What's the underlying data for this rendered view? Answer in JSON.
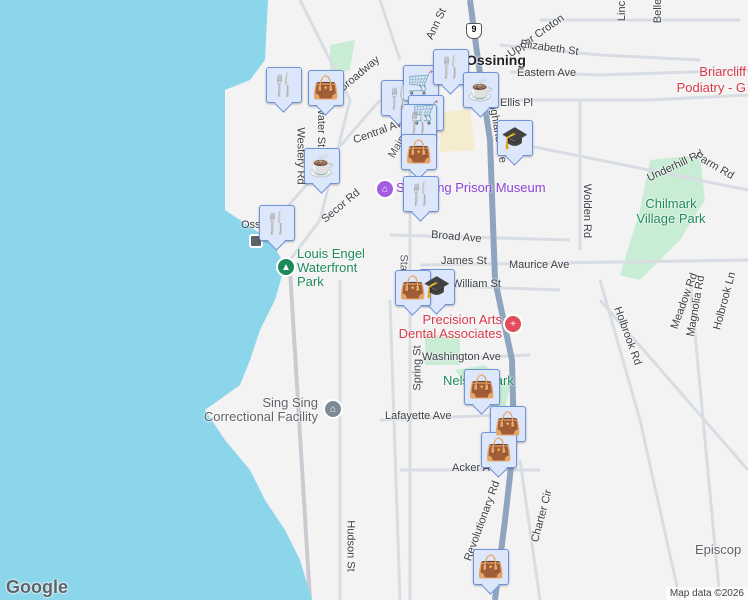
{
  "map": {
    "colors": {
      "water": "#8cd6ec",
      "land": "#f4f3f3",
      "park": "#c9ecd4",
      "highway": "#8fa4bf",
      "road": "#d8dde4",
      "marker_bg": "#dde7fb",
      "marker_icon": "#0b3f5c"
    },
    "route_shield": "9",
    "town": "Ossining",
    "streets": [
      "Upper Croton",
      "Elizabeth St",
      "Eastern Ave",
      "Ann St",
      "Broadway",
      "Water St",
      "Westery Rd",
      "Central Ave",
      "Ellis Pl",
      "Highland Ave",
      "Underhill Rd",
      "Farm Rd",
      "Wolden Rd",
      "Secor Rd",
      "Broad Ave",
      "James St",
      "Maurice Ave",
      "William St",
      "Washington Ave",
      "Spring St",
      "Lafayette Ave",
      "Acker Ave",
      "Meadow Rd",
      "Magnolia Rd",
      "Holbrook Ln",
      "Holbrook Rd",
      "Hudson St",
      "Revolutionary Rd",
      "Charter Cir",
      "Linc",
      "Belle",
      "State St",
      "Main St"
    ],
    "pois": {
      "podiatry": "Briarcliff Podiatry - G",
      "museum": "Sing Sing Prison Museum",
      "chilmark": "Chilmark Village Park",
      "waterfront": "Louis Engel Waterfront Park",
      "dental": "Precision Arts Dental Associates",
      "nelson": "Nelson Park",
      "singsing": "Sing Sing Correctional Facility",
      "episcopal": "Episcop",
      "station": "Ossining"
    },
    "markers": [
      {
        "type": "restaurant",
        "icon": "fork-knife"
      },
      {
        "type": "shopping",
        "icon": "shopping-bag"
      },
      {
        "type": "restaurant",
        "icon": "fork-knife"
      },
      {
        "type": "grocery",
        "icon": "shopping-cart"
      },
      {
        "type": "restaurant",
        "icon": "fork-knife"
      },
      {
        "type": "cafe",
        "icon": "coffee-cup"
      },
      {
        "type": "grocery",
        "icon": "shopping-cart"
      },
      {
        "type": "restaurant",
        "icon": "fork-knife"
      },
      {
        "type": "school",
        "icon": "graduation-cap"
      },
      {
        "type": "shopping",
        "icon": "shopping-bag"
      },
      {
        "type": "cafe",
        "icon": "coffee-cup"
      },
      {
        "type": "restaurant",
        "icon": "fork-knife"
      },
      {
        "type": "restaurant",
        "icon": "fork-knife"
      },
      {
        "type": "school",
        "icon": "graduation-cap"
      },
      {
        "type": "shopping",
        "icon": "shopping-bag"
      },
      {
        "type": "shopping",
        "icon": "shopping-bag"
      },
      {
        "type": "shopping",
        "icon": "shopping-bag"
      },
      {
        "type": "shopping",
        "icon": "shopping-bag"
      },
      {
        "type": "shopping",
        "icon": "shopping-bag"
      }
    ],
    "glyphs": {
      "fork-knife": "🍴",
      "shopping-bag": "👜",
      "shopping-cart": "🛒",
      "coffee-cup": "☕",
      "graduation-cap": "🎓"
    },
    "logo": "Google",
    "attribution": "Map data ©2026"
  }
}
